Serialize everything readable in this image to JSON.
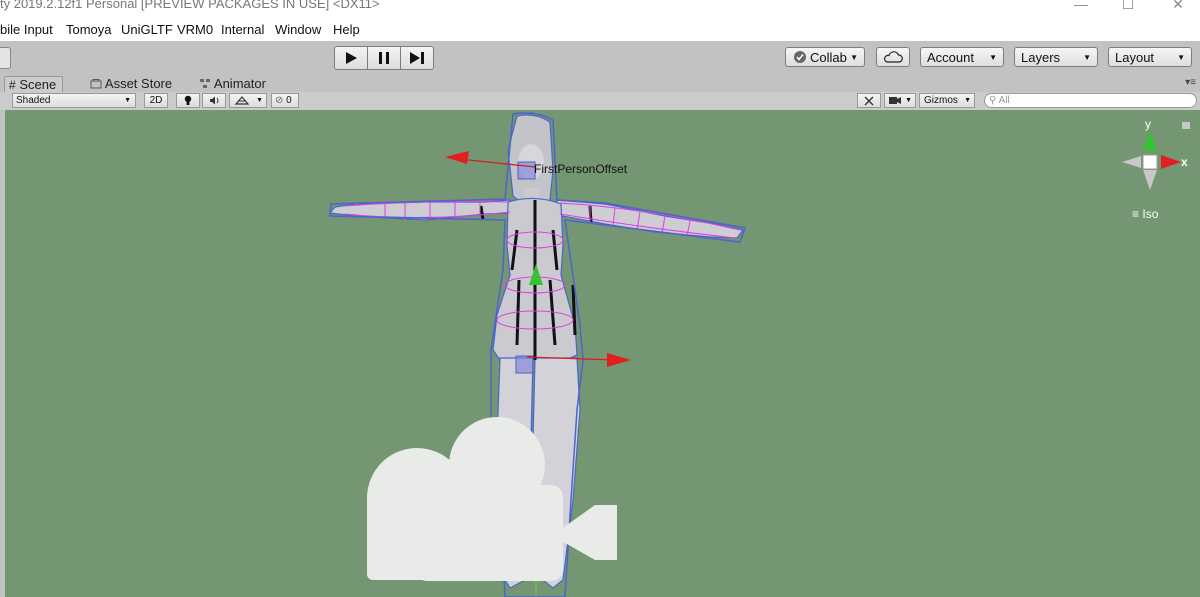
{
  "window": {
    "title": "ty 2019.2.12f1 Personal [PREVIEW PACKAGES IN USE] <DX11>",
    "minimize_glyph": "—",
    "maximize_glyph": "☐",
    "close_glyph": "✕"
  },
  "menu": {
    "items": [
      "bile Input",
      "Tomoya",
      "UniGLTF",
      "VRM0",
      "Internal",
      "Window",
      "Help"
    ]
  },
  "toolbar": {
    "collab_label": "Collab",
    "account_label": "Account",
    "layers_label": "Layers",
    "layout_label": "Layout",
    "caret": "▼"
  },
  "tabs": {
    "scene": "Scene",
    "asset_store": "Asset Store",
    "animator": "Animator",
    "menu_glyph": "▾≡"
  },
  "scene_toolbar": {
    "shading_mode": "Shaded",
    "mode_2d": "2D",
    "hidden_count": "0",
    "gizmos_label": "Gizmos",
    "search_placeholder": "All"
  },
  "scene": {
    "object_label": "FirstPersonOffset",
    "axis_y": "y",
    "axis_x": "x",
    "projection": "Iso",
    "projection_glyph": "≡"
  },
  "colors": {
    "scene_bg": "#749673",
    "axis_x": "#e02020",
    "axis_y": "#35c235",
    "selection_outline": "#4a66c8",
    "bone_wire": "#e040e0"
  }
}
